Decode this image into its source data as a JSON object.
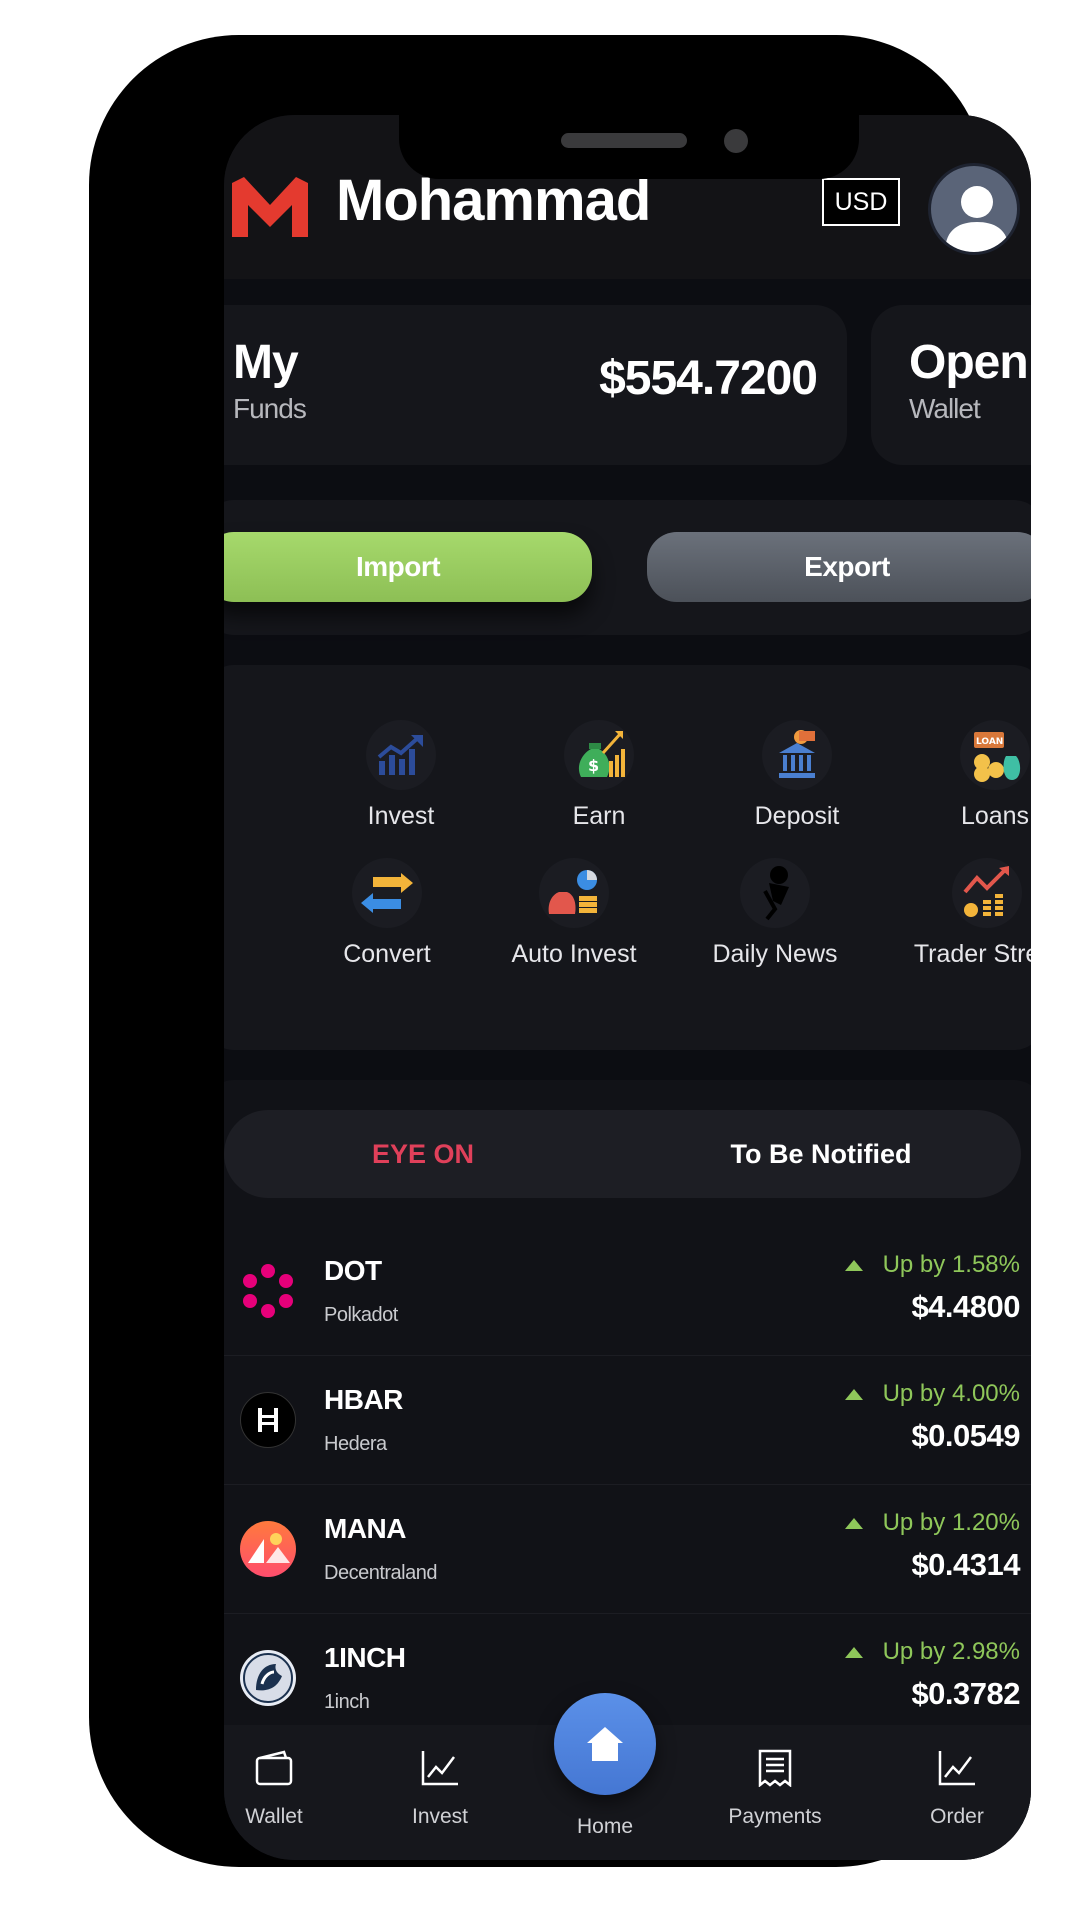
{
  "header": {
    "username": "Mohammad",
    "currency": "USD",
    "logo_icon": "m-logo-icon",
    "avatar_icon": "user-avatar-icon",
    "brand_color": "#e43a2f"
  },
  "cards": {
    "funds_title": "My",
    "funds_sub": "Funds",
    "funds_amount": "$554.7200",
    "wallet_title": "Open",
    "wallet_sub": "Wallet"
  },
  "actions": {
    "import_label": "Import",
    "export_label": "Export",
    "import_color": "#9ccd62",
    "export_color": "#5c6169"
  },
  "services": [
    {
      "label": "Invest",
      "icon": "chart-up-icon"
    },
    {
      "label": "Earn",
      "icon": "money-bag-icon"
    },
    {
      "label": "Deposit",
      "icon": "bank-icon"
    },
    {
      "label": "Loans",
      "icon": "loan-icon"
    },
    {
      "label": "Convert",
      "icon": "exchange-arrows-icon"
    },
    {
      "label": "Auto Invest",
      "icon": "auto-invest-icon"
    },
    {
      "label": "Daily News",
      "icon": "megaphone-icon"
    },
    {
      "label": "Trader Street",
      "icon": "trading-chart-icon"
    }
  ],
  "tabs": {
    "eye_on": "EYE ON",
    "to_be_notified": "To Be Notified",
    "active_color": "#e0405a"
  },
  "coins": [
    {
      "symbol": "DOT",
      "name": "Polkadot",
      "change": "Up by 1.58%",
      "price": "$4.4800",
      "icon": "polkadot-icon"
    },
    {
      "symbol": "HBAR",
      "name": "Hedera",
      "change": "Up by 4.00%",
      "price": "$0.0549",
      "icon": "hedera-icon"
    },
    {
      "symbol": "MANA",
      "name": "Decentraland",
      "change": "Up by 1.20%",
      "price": "$0.4314",
      "icon": "decentraland-icon"
    },
    {
      "symbol": "1INCH",
      "name": "1inch",
      "change": "Up by 2.98%",
      "price": "$0.3782",
      "icon": "1inch-icon"
    }
  ],
  "bottom_nav": {
    "wallet": "Wallet",
    "invest": "Invest",
    "home": "Home",
    "payments": "Payments",
    "order": "Order",
    "home_color": "#4f84de"
  }
}
